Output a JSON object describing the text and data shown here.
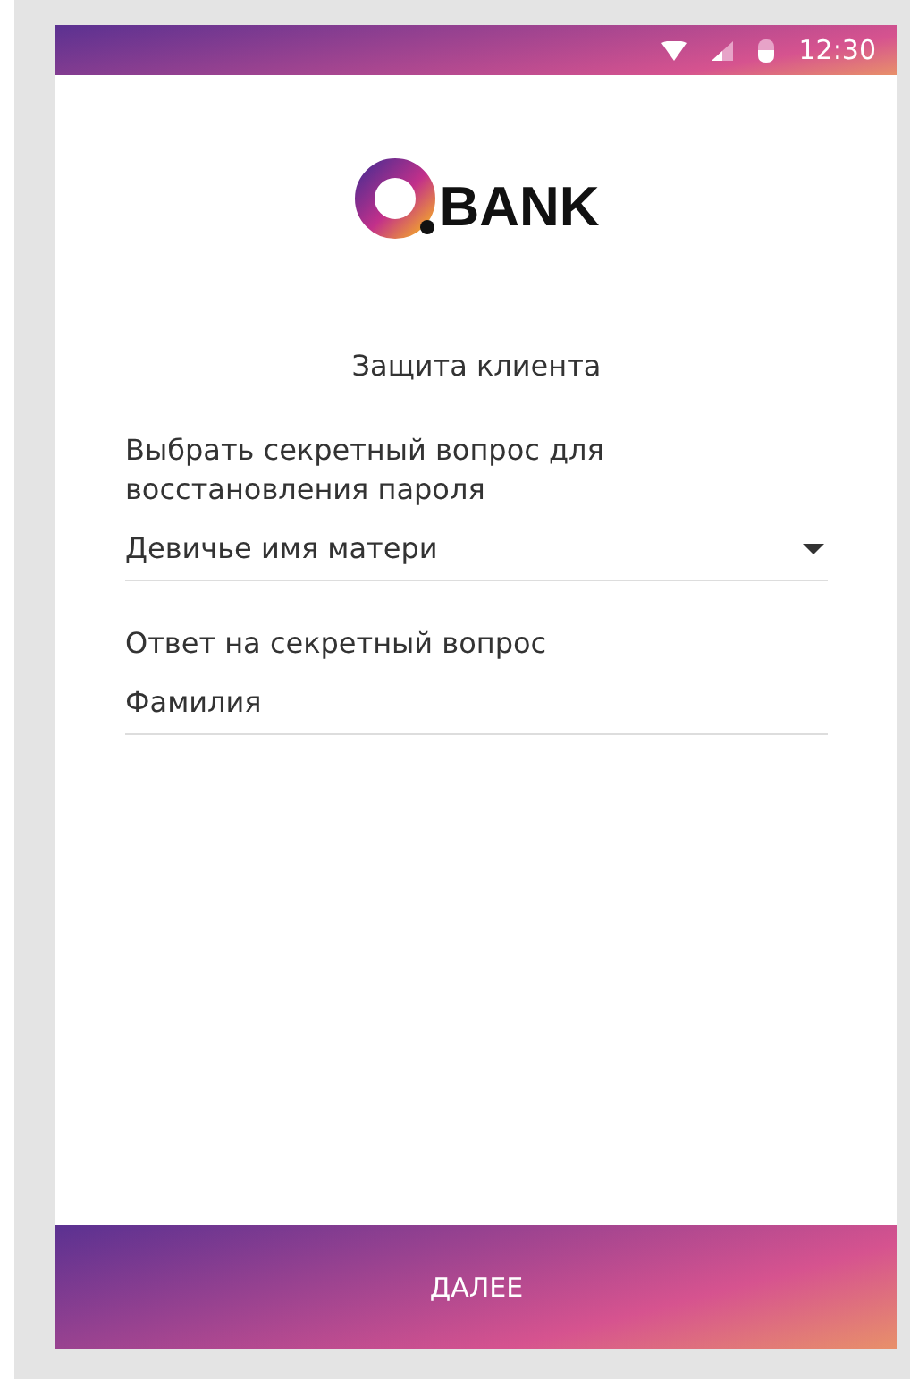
{
  "status_bar": {
    "time": "12:30"
  },
  "logo": {
    "text": "BANK"
  },
  "title": "Защита клиента",
  "fields": [
    {
      "kind": "select",
      "label": "Выбрать секретный вопрос для восстановления пароля",
      "value": "Девичье  имя матери"
    },
    {
      "kind": "text",
      "label": "Ответ на секретный вопрос",
      "value": "Фамилия"
    }
  ],
  "button": "ДАЛЕЕ"
}
